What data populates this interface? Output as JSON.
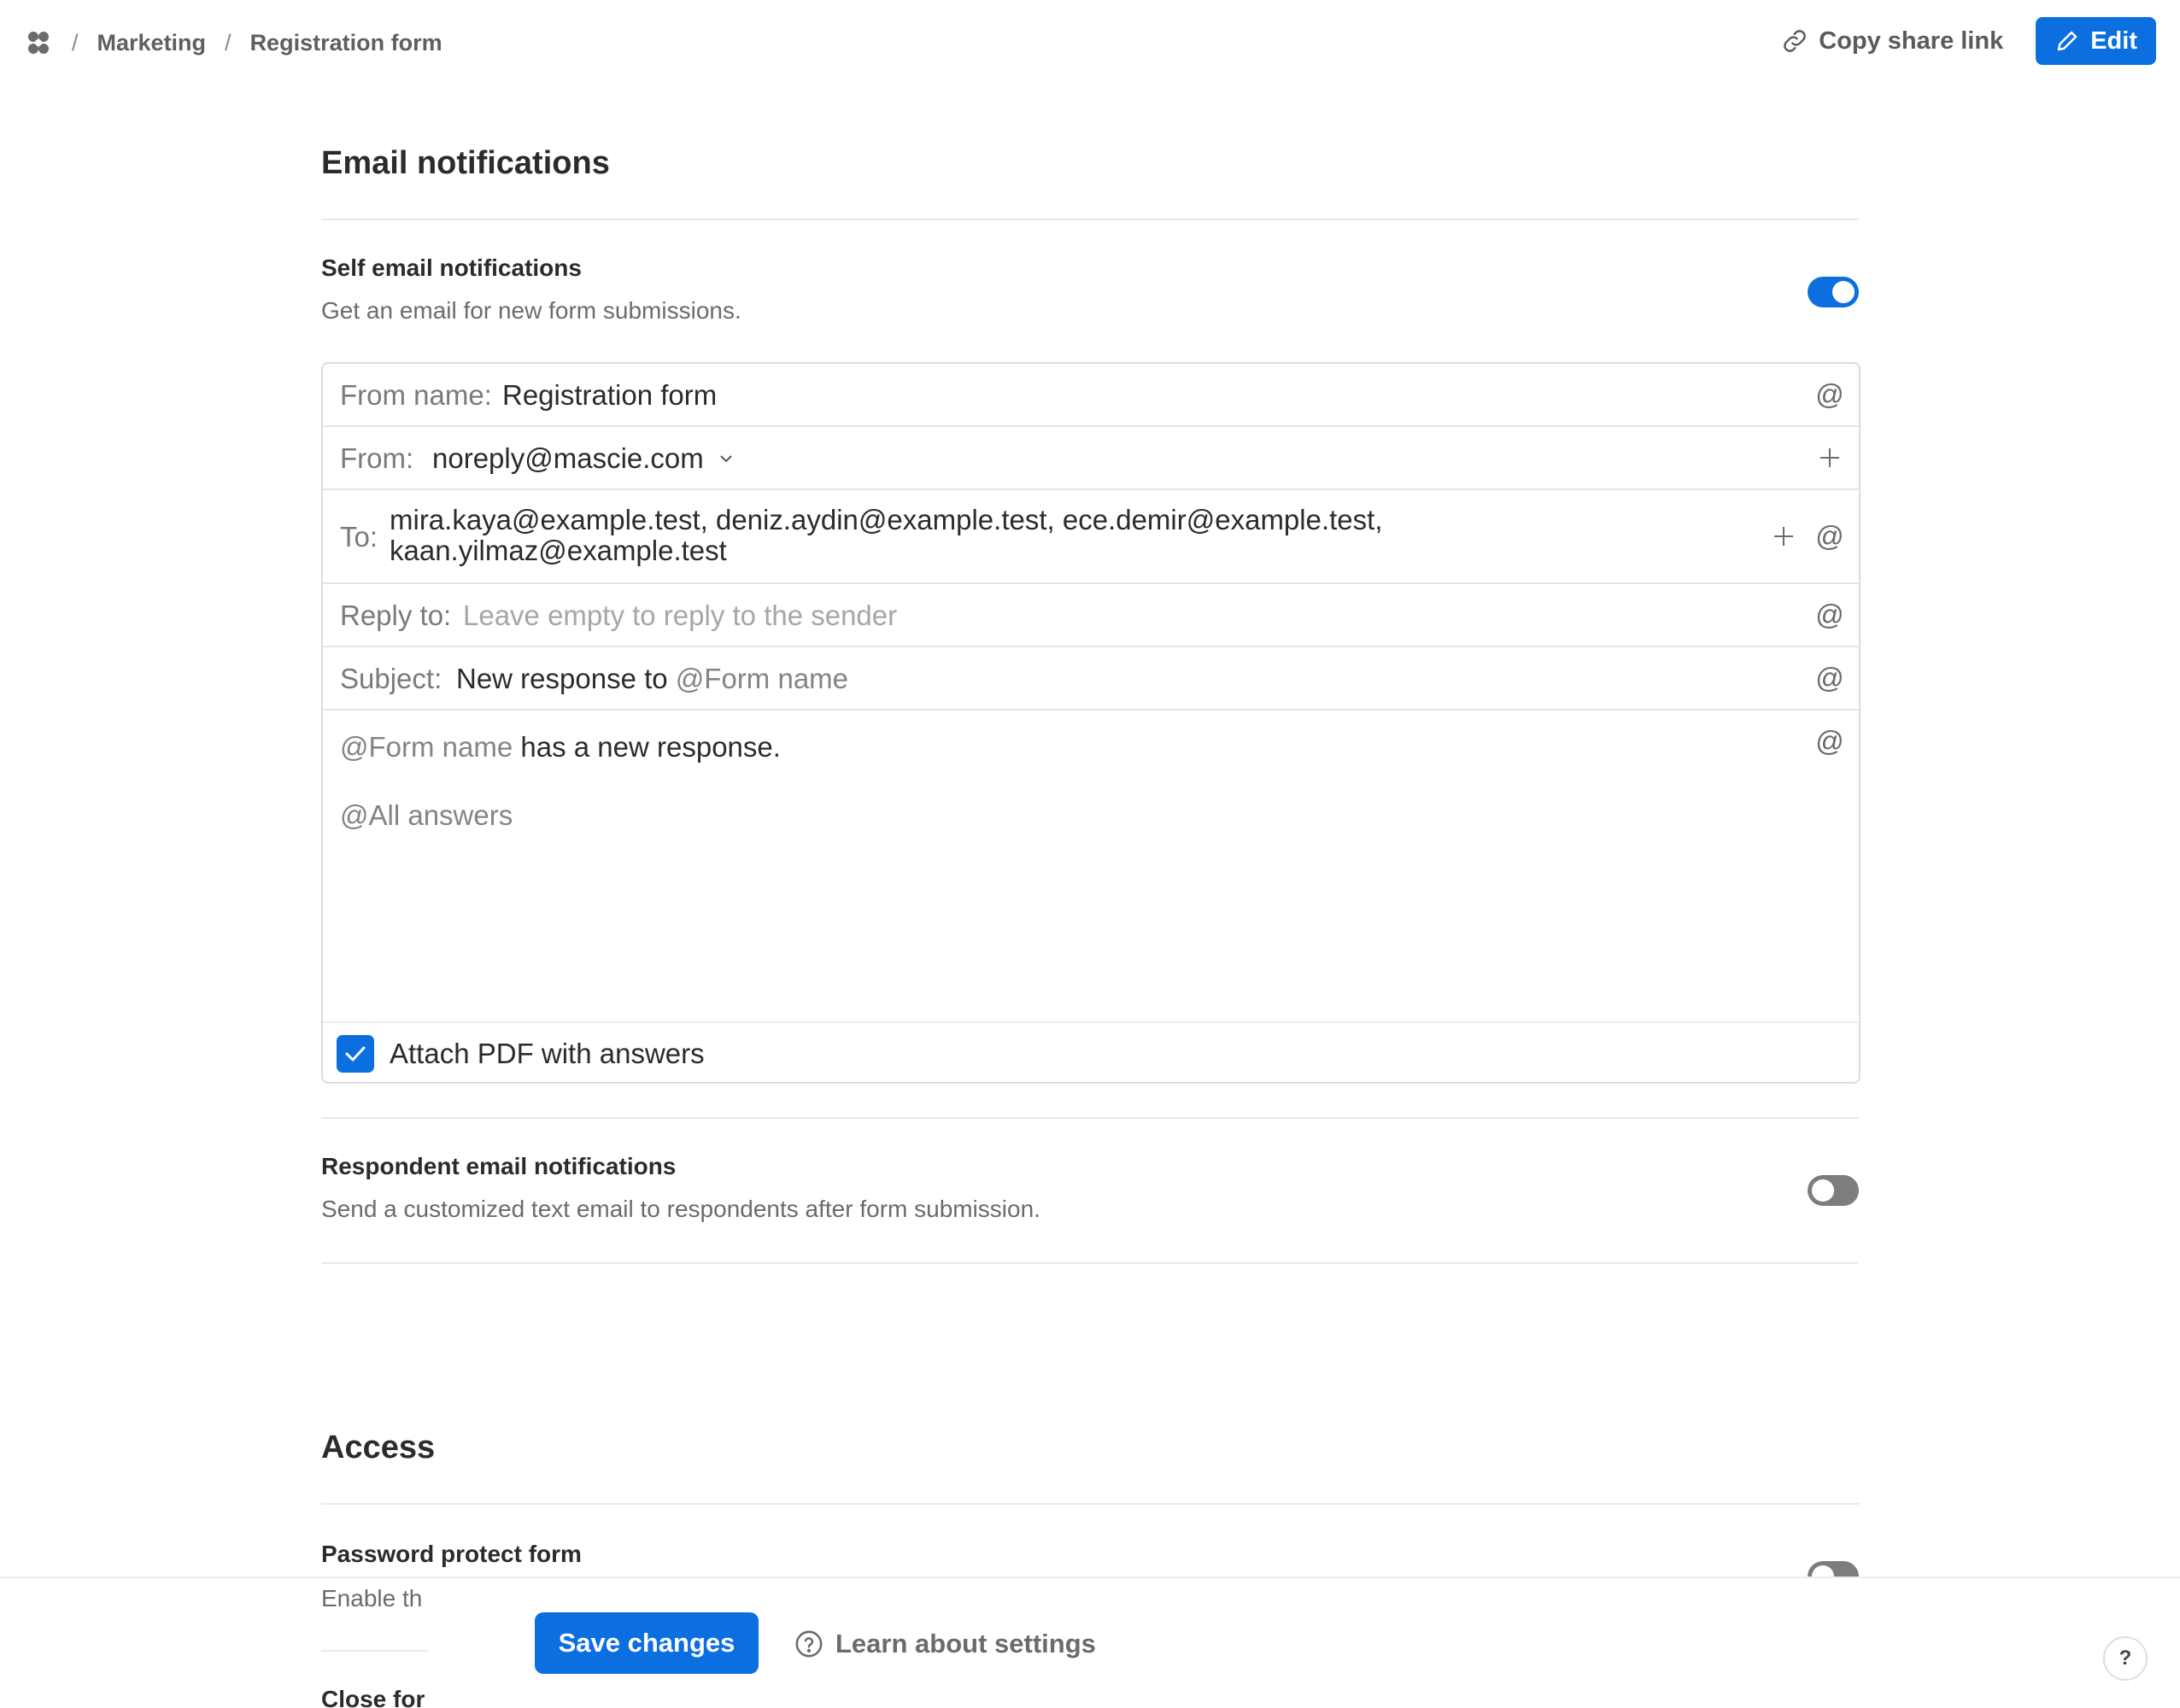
{
  "breadcrumb": {
    "items": [
      "Marketing",
      "Registration form"
    ],
    "separator": "/"
  },
  "header": {
    "share_label": "Copy share link",
    "edit_label": "Edit"
  },
  "email_notifications": {
    "title": "Email notifications",
    "self": {
      "title": "Self email notifications",
      "description": "Get an email for new form submissions.",
      "enabled": true
    },
    "card": {
      "from_name_label": "From name:",
      "from_name_value": "Registration form",
      "from_label": "From:",
      "from_value": "noreply@mascie.com",
      "to_label": "To:",
      "to_line1": "mira.kaya@example.test, deniz.aydin@example.test, ece.demir@example.test,",
      "to_line2": "kaan.yilmaz@example.test",
      "reply_to_label": "Reply to:",
      "reply_to_placeholder": "Leave empty to reply to the sender",
      "subject_label": "Subject:",
      "subject_text": "New response to",
      "subject_mention": "@Form name",
      "body_mention": "@Form name",
      "body_text": "has a new response.",
      "body_all_answers": "@All answers",
      "attach_label": "Attach PDF with answers",
      "attach_checked": true
    },
    "respondent": {
      "title": "Respondent email notifications",
      "description": "Send a customized text email to respondents after form submission.",
      "enabled": false
    }
  },
  "access": {
    "title": "Access",
    "password": {
      "title": "Password protect form",
      "description_visible": "Enable th",
      "enabled": false
    },
    "close_form_visible": "Close for"
  },
  "footer": {
    "save_label": "Save changes",
    "learn_label": "Learn about settings",
    "help_label": "?"
  },
  "colors": {
    "accent": "#0b6fe0",
    "toggle_off": "#7d7d7d"
  }
}
